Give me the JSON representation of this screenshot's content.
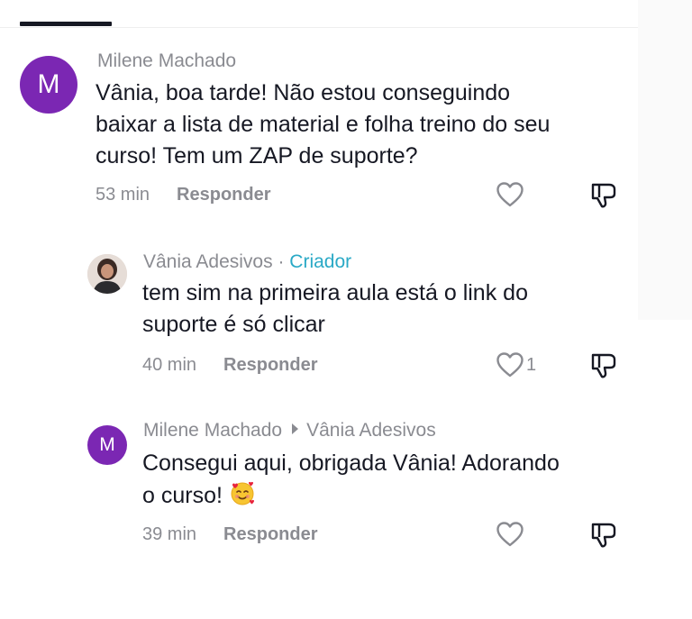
{
  "comments": [
    {
      "avatar_letter": "M",
      "author": "Milene Machado",
      "text_lines": [
        "Vânia, boa tarde! Não estou conseguindo",
        "baixar a lista de material e folha treino do seu",
        "curso! Tem um ZAP de suporte?"
      ],
      "time": "53 min",
      "reply_label": "Responder",
      "like_count": ""
    },
    {
      "author": "Vânia Adesivos",
      "separator": "·",
      "badge": "Criador",
      "text_lines": [
        "tem sim na primeira aula está o link do",
        "suporte é só clicar"
      ],
      "time": "40 min",
      "reply_label": "Responder",
      "like_count": "1"
    },
    {
      "avatar_letter": "M",
      "author": "Milene Machado",
      "reply_to": "Vânia Adesivos",
      "text_lines": [
        "Consegui aqui, obrigada Vânia! Adorando",
        "o curso!"
      ],
      "time": "39 min",
      "reply_label": "Responder",
      "like_count": ""
    }
  ],
  "colors": {
    "avatar_purple": "#7b27b3",
    "creator_badge": "#2aa9c6",
    "meta_gray": "#8a8b91",
    "text_dark": "#161823"
  },
  "icons": [
    "heart-outline-icon",
    "dislike-icon",
    "smiling-face-with-hearts-emoji",
    "play-arrow-icon"
  ]
}
